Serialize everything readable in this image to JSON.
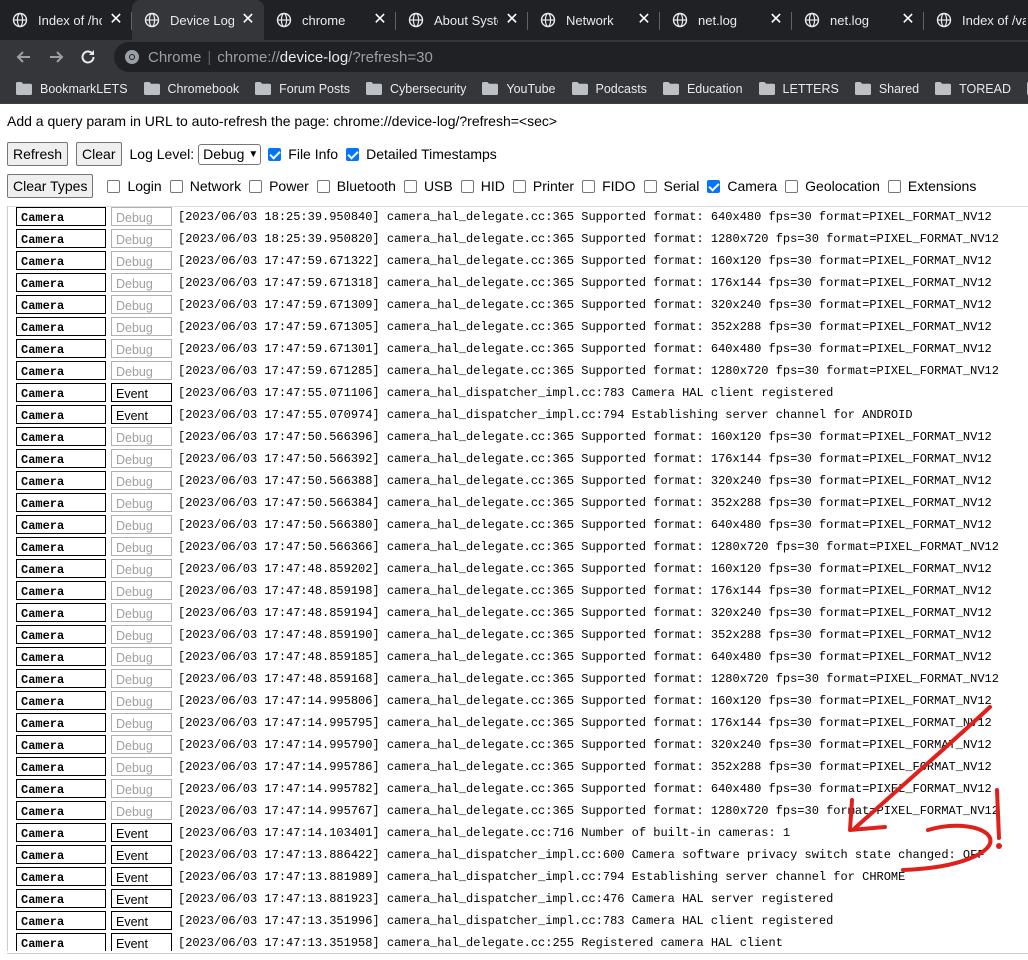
{
  "tabs": [
    {
      "title": "Index of /home",
      "active": false
    },
    {
      "title": "Device Log",
      "active": true
    },
    {
      "title": "chrome",
      "active": false
    },
    {
      "title": "About System",
      "active": false
    },
    {
      "title": "Network",
      "active": false
    },
    {
      "title": "net.log",
      "active": false
    },
    {
      "title": "net.log",
      "active": false
    },
    {
      "title": "Index of /var",
      "active": false
    }
  ],
  "omnibox": {
    "chip": "Chrome",
    "url_scheme": "chrome://",
    "url_host": "device-log",
    "url_rest": "/?refresh=30"
  },
  "bookmarks": [
    "BookmarkLETS",
    "Chromebook",
    "Forum Posts",
    "Cybersecurity",
    "YouTube",
    "Podcasts",
    "Education",
    "LETTERS",
    "Shared",
    "TOREAD",
    "D"
  ],
  "page": {
    "hint": "Add a query param in URL to auto-refresh the page: chrome://device-log/?refresh=<sec>",
    "refresh_label": "Refresh",
    "clear_label": "Clear",
    "log_level_label": "Log Level:",
    "log_level_value": "Debug",
    "file_info_label": "File Info",
    "file_info_checked": true,
    "detailed_ts_label": "Detailed Timestamps",
    "detailed_ts_checked": true,
    "clear_types_label": "Clear Types",
    "types": [
      {
        "label": "Login",
        "checked": false
      },
      {
        "label": "Network",
        "checked": false
      },
      {
        "label": "Power",
        "checked": false
      },
      {
        "label": "Bluetooth",
        "checked": false
      },
      {
        "label": "USB",
        "checked": false
      },
      {
        "label": "HID",
        "checked": false
      },
      {
        "label": "Printer",
        "checked": false
      },
      {
        "label": "FIDO",
        "checked": false
      },
      {
        "label": "Serial",
        "checked": false
      },
      {
        "label": "Camera",
        "checked": true
      },
      {
        "label": "Geolocation",
        "checked": false
      },
      {
        "label": "Extensions",
        "checked": false
      }
    ]
  },
  "log": [
    {
      "type": "Camera",
      "level": "Debug",
      "msg": "[2023/06/03 18:25:39.950840] camera_hal_delegate.cc:365 Supported format: 640x480 fps=30 format=PIXEL_FORMAT_NV12"
    },
    {
      "type": "Camera",
      "level": "Debug",
      "msg": "[2023/06/03 18:25:39.950820] camera_hal_delegate.cc:365 Supported format: 1280x720 fps=30 format=PIXEL_FORMAT_NV12"
    },
    {
      "type": "Camera",
      "level": "Debug",
      "msg": "[2023/06/03 17:47:59.671322] camera_hal_delegate.cc:365 Supported format: 160x120 fps=30 format=PIXEL_FORMAT_NV12"
    },
    {
      "type": "Camera",
      "level": "Debug",
      "msg": "[2023/06/03 17:47:59.671318] camera_hal_delegate.cc:365 Supported format: 176x144 fps=30 format=PIXEL_FORMAT_NV12"
    },
    {
      "type": "Camera",
      "level": "Debug",
      "msg": "[2023/06/03 17:47:59.671309] camera_hal_delegate.cc:365 Supported format: 320x240 fps=30 format=PIXEL_FORMAT_NV12"
    },
    {
      "type": "Camera",
      "level": "Debug",
      "msg": "[2023/06/03 17:47:59.671305] camera_hal_delegate.cc:365 Supported format: 352x288 fps=30 format=PIXEL_FORMAT_NV12"
    },
    {
      "type": "Camera",
      "level": "Debug",
      "msg": "[2023/06/03 17:47:59.671301] camera_hal_delegate.cc:365 Supported format: 640x480 fps=30 format=PIXEL_FORMAT_NV12"
    },
    {
      "type": "Camera",
      "level": "Debug",
      "msg": "[2023/06/03 17:47:59.671285] camera_hal_delegate.cc:365 Supported format: 1280x720 fps=30 format=PIXEL_FORMAT_NV12"
    },
    {
      "type": "Camera",
      "level": "Event",
      "msg": "[2023/06/03 17:47:55.071106] camera_hal_dispatcher_impl.cc:783 Camera HAL client registered"
    },
    {
      "type": "Camera",
      "level": "Event",
      "msg": "[2023/06/03 17:47:55.070974] camera_hal_dispatcher_impl.cc:794 Establishing server channel for ANDROID"
    },
    {
      "type": "Camera",
      "level": "Debug",
      "msg": "[2023/06/03 17:47:50.566396] camera_hal_delegate.cc:365 Supported format: 160x120 fps=30 format=PIXEL_FORMAT_NV12"
    },
    {
      "type": "Camera",
      "level": "Debug",
      "msg": "[2023/06/03 17:47:50.566392] camera_hal_delegate.cc:365 Supported format: 176x144 fps=30 format=PIXEL_FORMAT_NV12"
    },
    {
      "type": "Camera",
      "level": "Debug",
      "msg": "[2023/06/03 17:47:50.566388] camera_hal_delegate.cc:365 Supported format: 320x240 fps=30 format=PIXEL_FORMAT_NV12"
    },
    {
      "type": "Camera",
      "level": "Debug",
      "msg": "[2023/06/03 17:47:50.566384] camera_hal_delegate.cc:365 Supported format: 352x288 fps=30 format=PIXEL_FORMAT_NV12"
    },
    {
      "type": "Camera",
      "level": "Debug",
      "msg": "[2023/06/03 17:47:50.566380] camera_hal_delegate.cc:365 Supported format: 640x480 fps=30 format=PIXEL_FORMAT_NV12"
    },
    {
      "type": "Camera",
      "level": "Debug",
      "msg": "[2023/06/03 17:47:50.566366] camera_hal_delegate.cc:365 Supported format: 1280x720 fps=30 format=PIXEL_FORMAT_NV12"
    },
    {
      "type": "Camera",
      "level": "Debug",
      "msg": "[2023/06/03 17:47:48.859202] camera_hal_delegate.cc:365 Supported format: 160x120 fps=30 format=PIXEL_FORMAT_NV12"
    },
    {
      "type": "Camera",
      "level": "Debug",
      "msg": "[2023/06/03 17:47:48.859198] camera_hal_delegate.cc:365 Supported format: 176x144 fps=30 format=PIXEL_FORMAT_NV12"
    },
    {
      "type": "Camera",
      "level": "Debug",
      "msg": "[2023/06/03 17:47:48.859194] camera_hal_delegate.cc:365 Supported format: 320x240 fps=30 format=PIXEL_FORMAT_NV12"
    },
    {
      "type": "Camera",
      "level": "Debug",
      "msg": "[2023/06/03 17:47:48.859190] camera_hal_delegate.cc:365 Supported format: 352x288 fps=30 format=PIXEL_FORMAT_NV12"
    },
    {
      "type": "Camera",
      "level": "Debug",
      "msg": "[2023/06/03 17:47:48.859185] camera_hal_delegate.cc:365 Supported format: 640x480 fps=30 format=PIXEL_FORMAT_NV12"
    },
    {
      "type": "Camera",
      "level": "Debug",
      "msg": "[2023/06/03 17:47:48.859168] camera_hal_delegate.cc:365 Supported format: 1280x720 fps=30 format=PIXEL_FORMAT_NV12"
    },
    {
      "type": "Camera",
      "level": "Debug",
      "msg": "[2023/06/03 17:47:14.995806] camera_hal_delegate.cc:365 Supported format: 160x120 fps=30 format=PIXEL_FORMAT_NV12"
    },
    {
      "type": "Camera",
      "level": "Debug",
      "msg": "[2023/06/03 17:47:14.995795] camera_hal_delegate.cc:365 Supported format: 176x144 fps=30 format=PIXEL_FORMAT_NV12"
    },
    {
      "type": "Camera",
      "level": "Debug",
      "msg": "[2023/06/03 17:47:14.995790] camera_hal_delegate.cc:365 Supported format: 320x240 fps=30 format=PIXEL_FORMAT_NV12"
    },
    {
      "type": "Camera",
      "level": "Debug",
      "msg": "[2023/06/03 17:47:14.995786] camera_hal_delegate.cc:365 Supported format: 352x288 fps=30 format=PIXEL_FORMAT_NV12"
    },
    {
      "type": "Camera",
      "level": "Debug",
      "msg": "[2023/06/03 17:47:14.995782] camera_hal_delegate.cc:365 Supported format: 640x480 fps=30 format=PIXEL_FORMAT_NV12"
    },
    {
      "type": "Camera",
      "level": "Debug",
      "msg": "[2023/06/03 17:47:14.995767] camera_hal_delegate.cc:365 Supported format: 1280x720 fps=30 format=PIXEL_FORMAT_NV12"
    },
    {
      "type": "Camera",
      "level": "Event",
      "msg": "[2023/06/03 17:47:14.103401] camera_hal_delegate.cc:716 Number of built-in cameras: 1"
    },
    {
      "type": "Camera",
      "level": "Event",
      "msg": "[2023/06/03 17:47:13.886422] camera_hal_dispatcher_impl.cc:600 Camera software privacy switch state changed: OFF"
    },
    {
      "type": "Camera",
      "level": "Event",
      "msg": "[2023/06/03 17:47:13.881989] camera_hal_dispatcher_impl.cc:794 Establishing server channel for CHROME"
    },
    {
      "type": "Camera",
      "level": "Event",
      "msg": "[2023/06/03 17:47:13.881923] camera_hal_dispatcher_impl.cc:476 Camera HAL server registered"
    },
    {
      "type": "Camera",
      "level": "Event",
      "msg": "[2023/06/03 17:47:13.351996] camera_hal_dispatcher_impl.cc:783 Camera HAL client registered"
    },
    {
      "type": "Camera",
      "level": "Event",
      "msg": "[2023/06/03 17:47:13.351958] camera_hal_delegate.cc:255 Registered camera HAL client"
    }
  ],
  "annotation": {
    "color": "#e0201a",
    "mark": "!"
  }
}
